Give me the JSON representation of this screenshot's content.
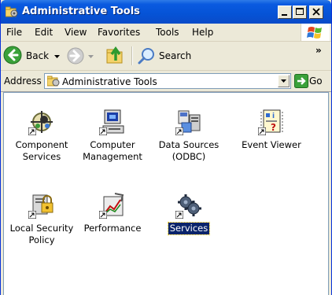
{
  "window": {
    "title": "Administrative Tools",
    "icon": "admin-tools-folder-icon",
    "controls": [
      "minimize-icon",
      "maximize-icon",
      "close-icon"
    ]
  },
  "menubar": {
    "items": [
      "File",
      "Edit",
      "View",
      "Favorites",
      "Tools",
      "Help"
    ],
    "overflow": "»"
  },
  "toolbar": {
    "back_label": "Back",
    "search_label": "Search"
  },
  "address": {
    "label": "Address",
    "value": "Administrative Tools",
    "go_label": "Go"
  },
  "content": {
    "items": [
      {
        "label_line1": "Component",
        "label_line2": "Services",
        "icon": "component-services-icon"
      },
      {
        "label_line1": "Computer",
        "label_line2": "Management",
        "icon": "computer-management-icon"
      },
      {
        "label_line1": "Data Sources",
        "label_line2": "(ODBC)",
        "icon": "data-sources-icon"
      },
      {
        "label_line1": "Event Viewer",
        "label_line2": "",
        "icon": "event-viewer-icon"
      },
      {
        "label_line1": "Local Security",
        "label_line2": "Policy",
        "icon": "local-security-policy-icon"
      },
      {
        "label_line1": "Performance",
        "label_line2": "",
        "icon": "performance-icon"
      },
      {
        "label_line1": "Services",
        "label_line2": "",
        "icon": "services-icon",
        "selected": true
      }
    ]
  },
  "colors": {
    "titlebar": "#0553d6",
    "selection": "#0a246a",
    "chrome": "#ece9d8"
  }
}
